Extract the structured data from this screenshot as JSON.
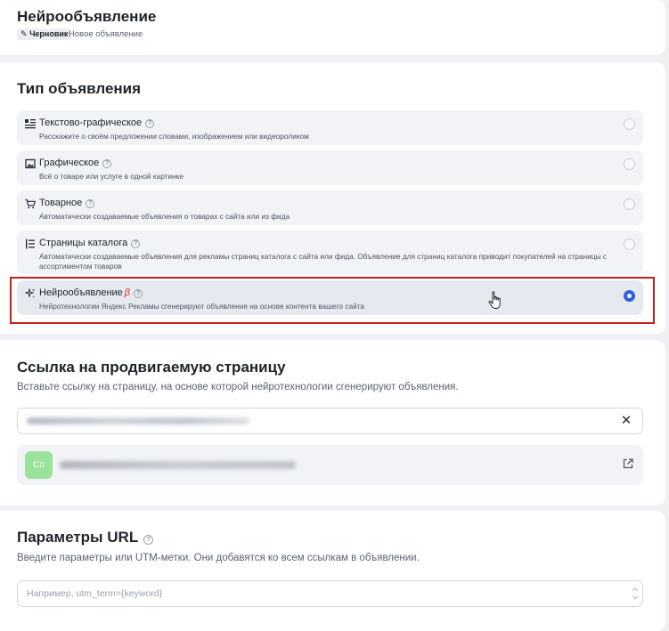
{
  "header": {
    "title": "Нейрообъявление",
    "status_badge": "Черновик",
    "ad_name": "Новое объявление"
  },
  "ad_type": {
    "title": "Тип объявления",
    "options": [
      {
        "title": "Текстово-графическое",
        "description": "Расскажите о своём предложении словами, изображением или видеороликом",
        "icon": "text-graphic-icon",
        "selected": false
      },
      {
        "title": "Графическое",
        "description": "Всё о товаре или услуге в одной картинке",
        "icon": "image-icon",
        "selected": false
      },
      {
        "title": "Товарное",
        "description": "Автоматически создаваемые объявления о товарах с сайта или из фида",
        "icon": "cart-icon",
        "selected": false
      },
      {
        "title": "Страницы каталога",
        "description": "Автоматически создаваемые объявления для рекламы страниц каталога с сайта или фида. Объявление для страниц каталога приводит покупателей на страницы с ассортиментом товаров",
        "icon": "catalog-icon",
        "selected": false
      },
      {
        "title": "Нейрообъявление",
        "beta": "β",
        "description": "Нейротехнологии Яндекс Рекламы сгенерируют объявления на основе контента вашего сайта",
        "icon": "sparkle-icon",
        "selected": true
      }
    ]
  },
  "link": {
    "title": "Ссылка на продвигаемую страницу",
    "description": "Вставьте ссылку на страницу, на основе которой нейротехнологии сгенерируют объявления.",
    "favicon_text": "Сп"
  },
  "url_params": {
    "title": "Параметры URL",
    "description": "Введите параметры или UTM-метки. Они добавятся ко всем ссылкам в объявлении.",
    "placeholder": "Например, utm_term={keyword}",
    "value": ""
  },
  "colors": {
    "accent": "#2f5fe0",
    "highlight": "#c81e1e",
    "beta": "#e6222a"
  }
}
